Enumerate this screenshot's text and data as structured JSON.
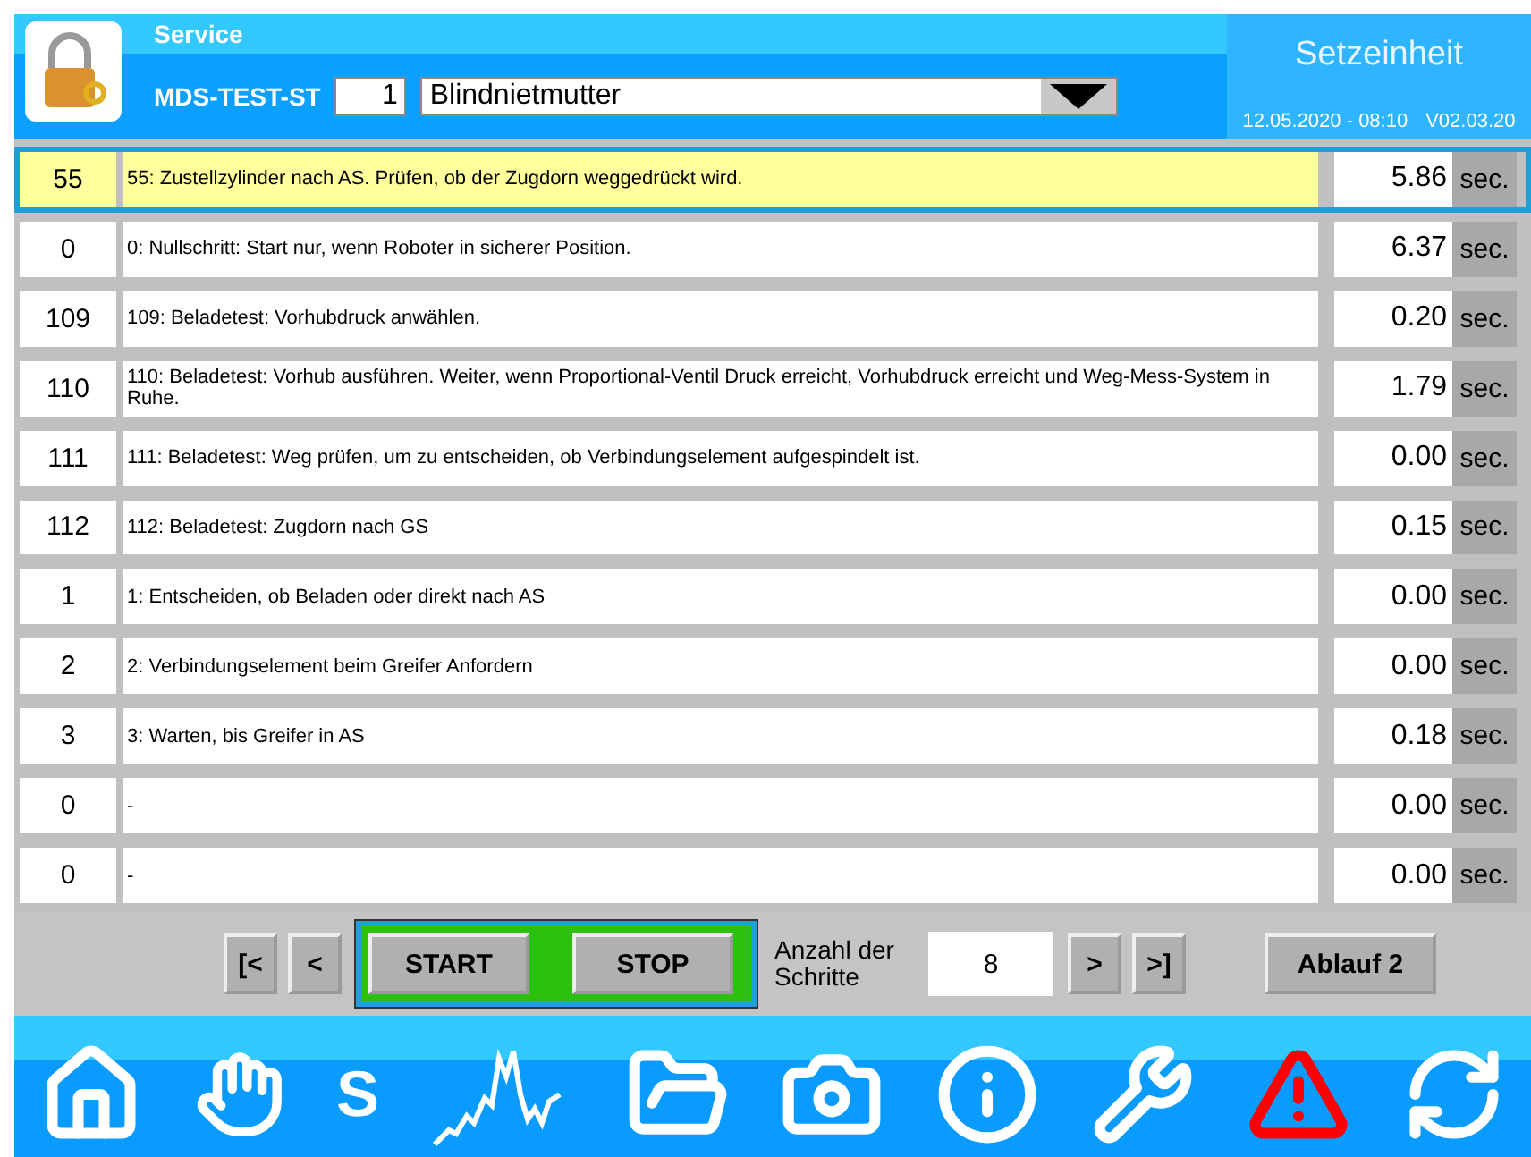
{
  "header": {
    "section": "Service",
    "machine": "MDS-TEST-ST",
    "program_number": "1",
    "program_name": "Blindnietmutter",
    "title": "Setzeinheit",
    "datetime": "12.05.2020 - 08:10",
    "version": "V02.03.20"
  },
  "steps": [
    {
      "number": "55",
      "text": "55: Zustellzylinder nach AS. Prüfen, ob der Zugdorn weggedrückt wird.",
      "time": "5.86",
      "unit": "sec.",
      "selected": true
    },
    {
      "number": "0",
      "text": "0: Nullschritt: Start nur, wenn Roboter in sicherer Position.",
      "time": "6.37",
      "unit": "sec.",
      "selected": false
    },
    {
      "number": "109",
      "text": "109: Beladetest: Vorhubdruck anwählen.",
      "time": "0.20",
      "unit": "sec.",
      "selected": false
    },
    {
      "number": "110",
      "text": "110: Beladetest: Vorhub ausführen. Weiter, wenn Proportional-Ventil Druck erreicht, Vorhubdruck erreicht und Weg-Mess-System in Ruhe.",
      "time": "1.79",
      "unit": "sec.",
      "selected": false
    },
    {
      "number": "111",
      "text": "111: Beladetest: Weg prüfen, um zu entscheiden, ob Verbindungselement aufgespindelt ist.",
      "time": "0.00",
      "unit": "sec.",
      "selected": false
    },
    {
      "number": "112",
      "text": "112: Beladetest: Zugdorn nach GS",
      "time": "0.15",
      "unit": "sec.",
      "selected": false
    },
    {
      "number": "1",
      "text": "1: Entscheiden, ob Beladen oder direkt nach AS",
      "time": "0.00",
      "unit": "sec.",
      "selected": false
    },
    {
      "number": "2",
      "text": "2: Verbindungselement beim Greifer Anfordern",
      "time": "0.00",
      "unit": "sec.",
      "selected": false
    },
    {
      "number": "3",
      "text": "3: Warten, bis Greifer in AS",
      "time": "0.18",
      "unit": "sec.",
      "selected": false
    },
    {
      "number": "0",
      "text": "-",
      "time": "0.00",
      "unit": "sec.",
      "selected": false
    },
    {
      "number": "0",
      "text": "-",
      "time": "0.00",
      "unit": "sec.",
      "selected": false
    }
  ],
  "controls": {
    "first": "[<",
    "prev": "<",
    "start": "START",
    "stop": "STOP",
    "steps_label": "Anzahl der Schritte",
    "steps_count": "8",
    "next": ">",
    "last": ">]",
    "sequence": "Ablauf 2"
  },
  "nav": [
    {
      "kind": "home"
    },
    {
      "kind": "hand"
    },
    {
      "kind": "letter",
      "text": "S"
    },
    {
      "kind": "chart"
    },
    {
      "kind": "folder"
    },
    {
      "kind": "camera"
    },
    {
      "kind": "info"
    },
    {
      "kind": "tools"
    },
    {
      "kind": "warning"
    },
    {
      "kind": "refresh"
    }
  ]
}
